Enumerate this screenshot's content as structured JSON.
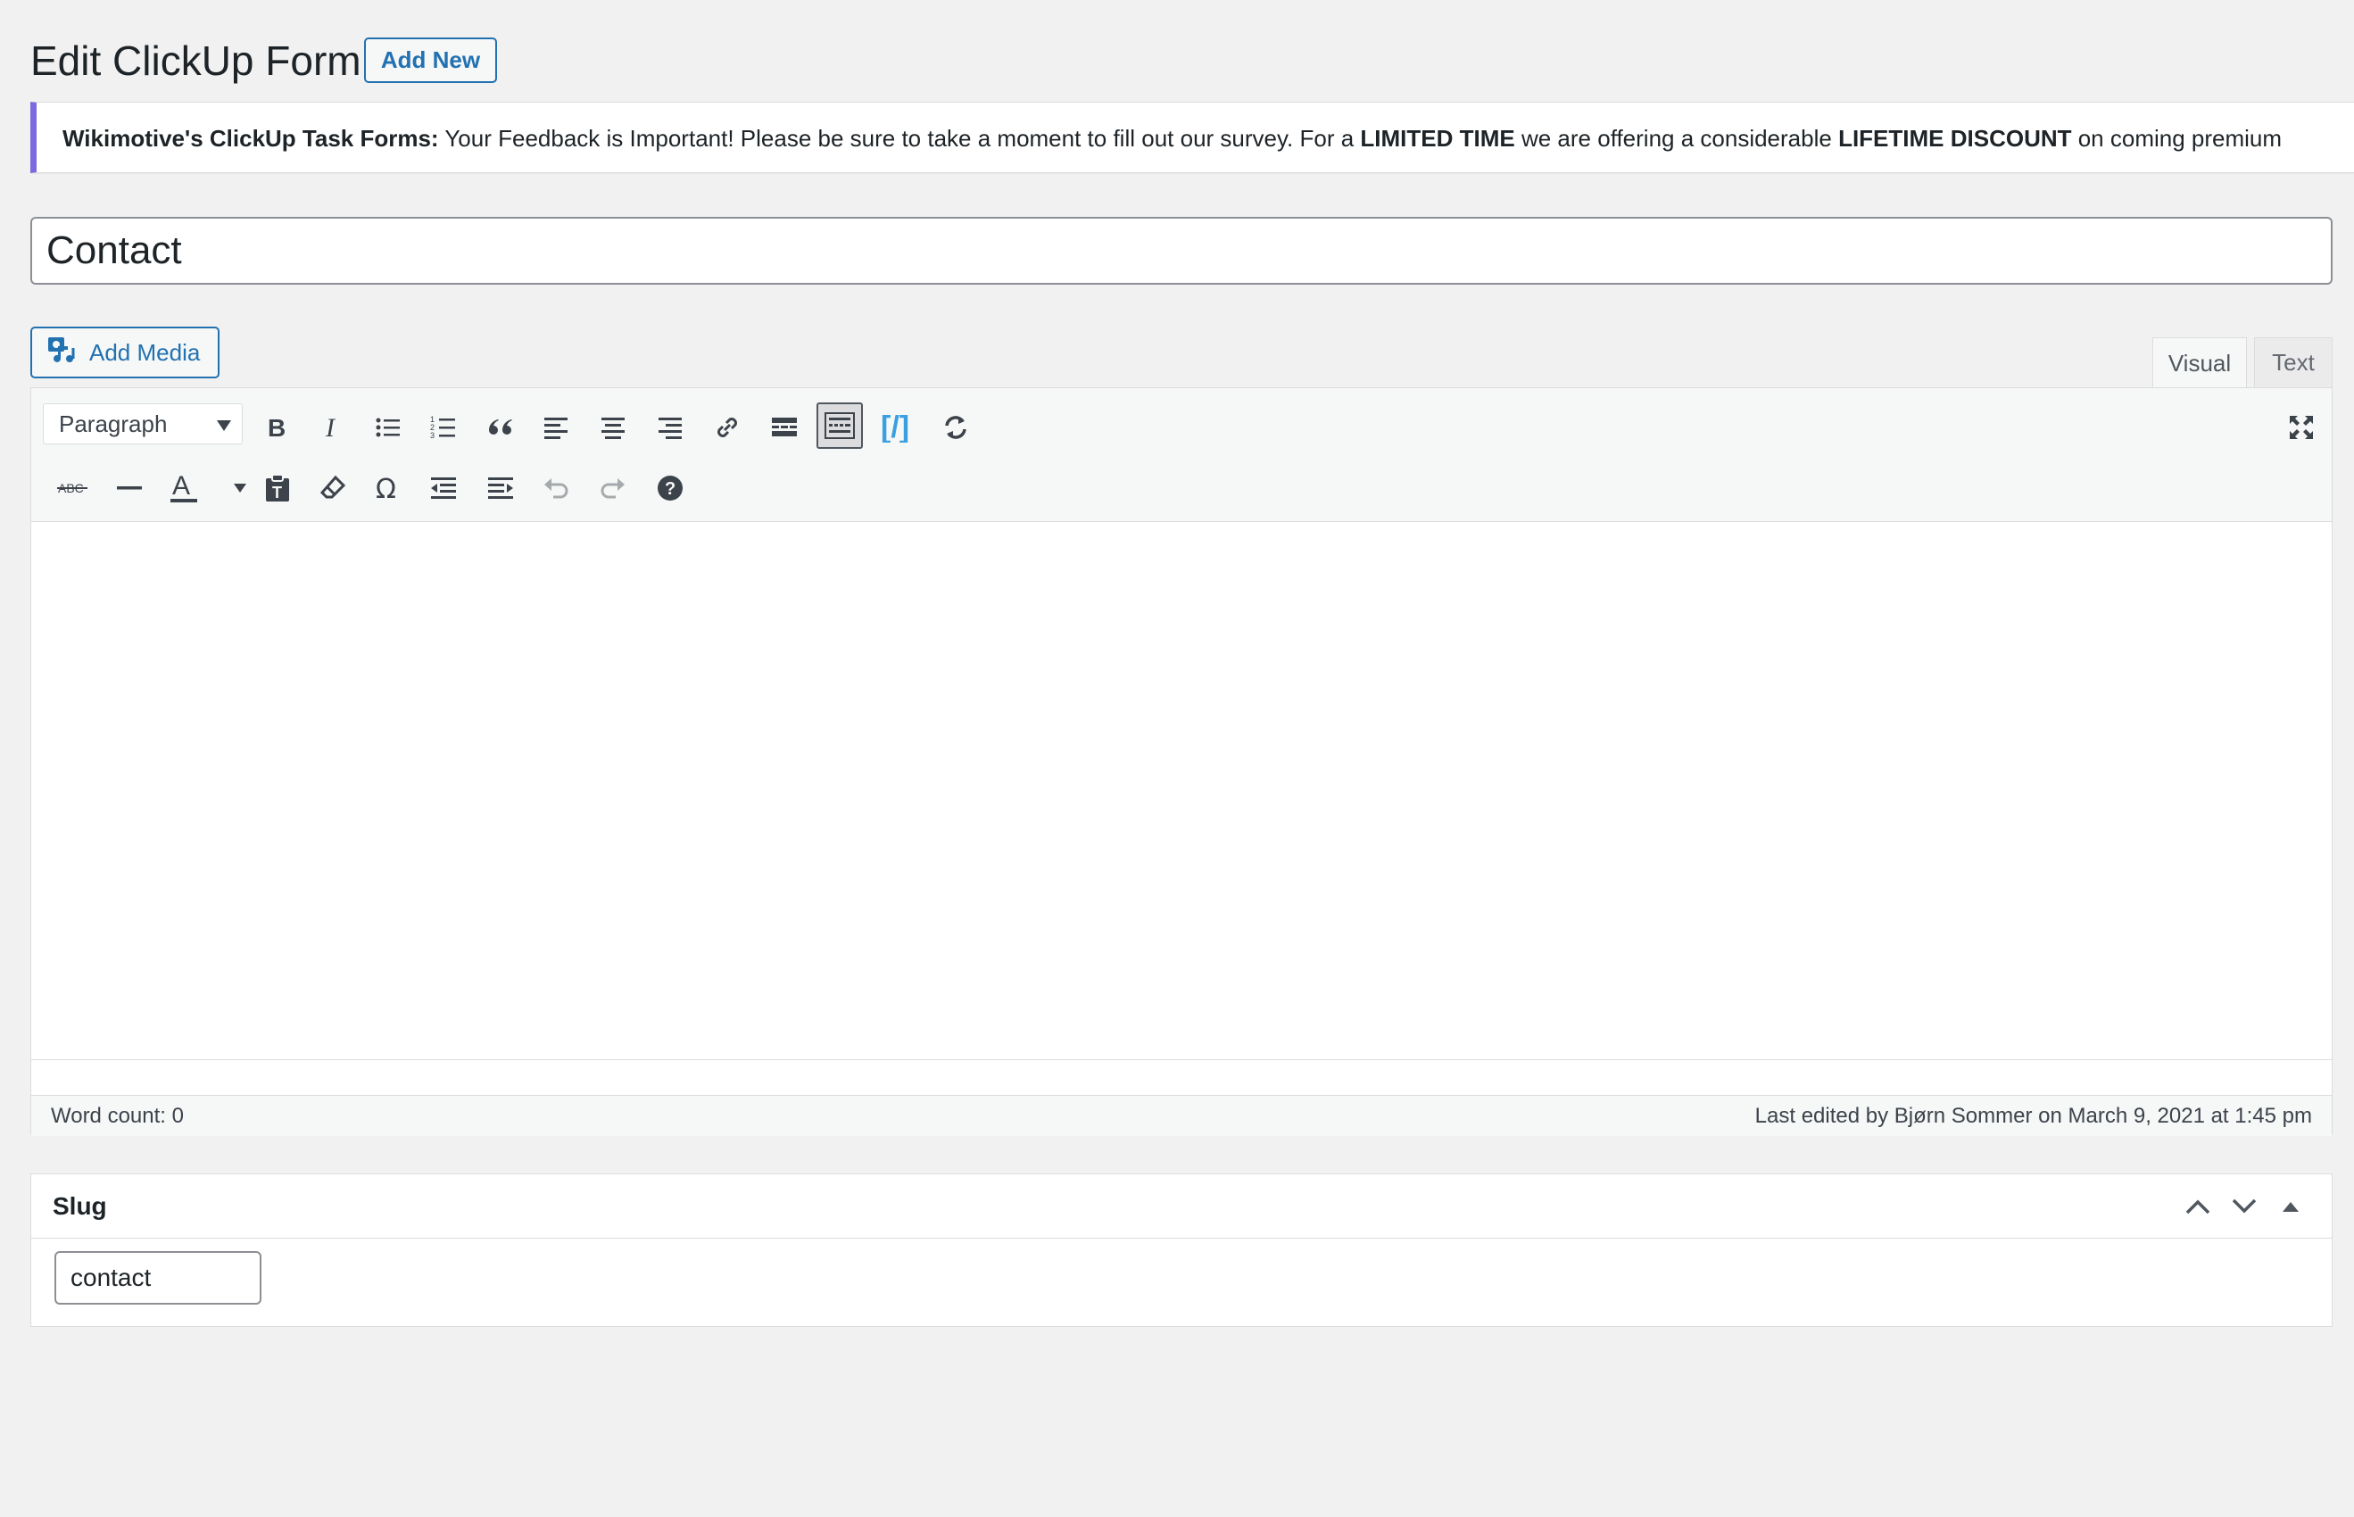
{
  "header": {
    "title": "Edit ClickUp Form",
    "add_new_label": "Add New"
  },
  "notice": {
    "brand": "Wikimotive's ClickUp Task Forms:",
    "text_1": " Your Feedback is Important! Please be sure to take a moment to fill out our survey. For a ",
    "strong_1": "LIMITED TIME",
    "text_2": " we are offering a considerable ",
    "strong_2": "LIFETIME DISCOUNT",
    "text_3": " on coming premium",
    "accent_color": "#7b69e0"
  },
  "post": {
    "title_value": "Contact"
  },
  "media": {
    "add_media_label": "Add Media"
  },
  "editor_tabs": {
    "visual": "Visual",
    "text": "Text",
    "active": "Visual"
  },
  "toolbar": {
    "format_select_value": "Paragraph",
    "row1_icons": [
      "bold-icon",
      "italic-icon",
      "bulleted-list-icon",
      "numbered-list-icon",
      "blockquote-icon",
      "align-left-icon",
      "align-center-icon",
      "align-right-icon",
      "link-icon",
      "read-more-icon",
      "toolbar-toggle-icon",
      "shortcode-icon",
      "refresh-icon",
      "fullscreen-icon"
    ],
    "row2_icons": [
      "strikethrough-icon",
      "horizontal-line-icon",
      "text-color-icon",
      "paste-as-text-icon",
      "clear-formatting-icon",
      "special-character-icon",
      "outdent-icon",
      "indent-icon",
      "undo-icon",
      "redo-icon",
      "help-icon"
    ]
  },
  "status_bar": {
    "word_count": "Word count: 0",
    "last_edited": "Last edited by Bjørn Sommer on March 9, 2021 at 1:45 pm"
  },
  "slug_box": {
    "title": "Slug",
    "value": "contact"
  },
  "colors": {
    "primary": "#2271b1",
    "shortcode_accent": "#3aa0e0"
  }
}
